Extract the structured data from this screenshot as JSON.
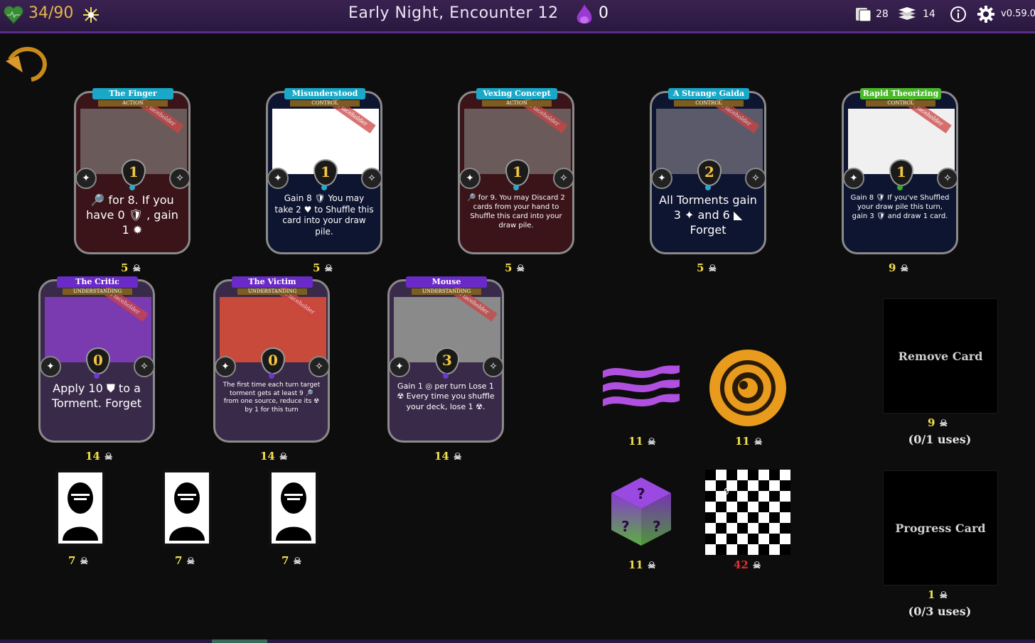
{
  "topbar": {
    "hp": "34/90",
    "title": "Early Night, Encounter 12",
    "orbs": "0",
    "deck_count": "28",
    "cards_count": "14",
    "version": "v0.59.0",
    "colors": {
      "hp": "#e3b64a",
      "accent": "#5a2d8a"
    }
  },
  "back_button": {
    "icon": "back-arrow-icon"
  },
  "cards": [
    {
      "title": "The Finger",
      "type": "ACTION",
      "cost": "1",
      "placeholder": "Placeholder",
      "text": "🔎 for 8. If you have 0 🛡 , gain 1 ✹",
      "price": "5"
    },
    {
      "title": "Misunderstood",
      "type": "CONTROL",
      "cost": "1",
      "placeholder": "Placeholder",
      "text": "Gain 8 🛡 You may take 2 ♥ to Shuffle this card into your draw pile.",
      "price": "5"
    },
    {
      "title": "Vexing Concept",
      "type": "ACTION",
      "cost": "1",
      "placeholder": "Placeholder",
      "text": "🔎 for 9. You may Discard 2 cards from your hand to Shuffle this card into your draw pile.",
      "price": "5"
    },
    {
      "title": "A Strange Gaida",
      "type": "CONTROL",
      "cost": "2",
      "placeholder": "Placeholder",
      "text": "All Torments gain 3 ✦ and 6 ◣ Forget",
      "price": "5"
    },
    {
      "title": "Rapid Theorizing",
      "type": "CONTROL",
      "cost": "1",
      "placeholder": "Placeholder",
      "text": "Gain 8 🛡 If you've Shuffled your draw pile this turn, gain 3 🛡 and draw 1 card.",
      "price": "9"
    },
    {
      "title": "The Critic",
      "type": "UNDERSTANDING",
      "cost": "0",
      "placeholder": "Placeholder",
      "text": "Apply 10 ⛊ to a Torment. Forget",
      "price": "14"
    },
    {
      "title": "The Victim",
      "type": "UNDERSTANDING",
      "cost": "0",
      "placeholder": "Placeholder",
      "text": "The first time each turn target torment gets at least 9 🔎 from one source, reduce its ☢ by 1 for this turn",
      "price": "14"
    },
    {
      "title": "Mouse",
      "type": "UNDERSTANDING",
      "cost": "3",
      "placeholder": "Placeholder",
      "text": "Gain 1 ◎ per turn Lose 1 ☢ Every time you shuffle your deck, lose 1 ☢.",
      "price": "14"
    }
  ],
  "portraits": [
    {
      "price": "7"
    },
    {
      "price": "7"
    },
    {
      "price": "7"
    }
  ],
  "relics": [
    {
      "icon": "purple-waves-icon",
      "price": "11"
    },
    {
      "icon": "orange-eye-icon",
      "price": "11"
    },
    {
      "icon": "mystery-dice-icon",
      "price": "11"
    },
    {
      "icon": "checkerboard-icon",
      "price": "42",
      "overlay": "0"
    }
  ],
  "services": {
    "remove": {
      "label": "Remove Card",
      "price": "9",
      "uses": "(0/1 uses)"
    },
    "progress": {
      "label": "Progress Card",
      "price": "1",
      "uses": "(0/3 uses)"
    }
  }
}
